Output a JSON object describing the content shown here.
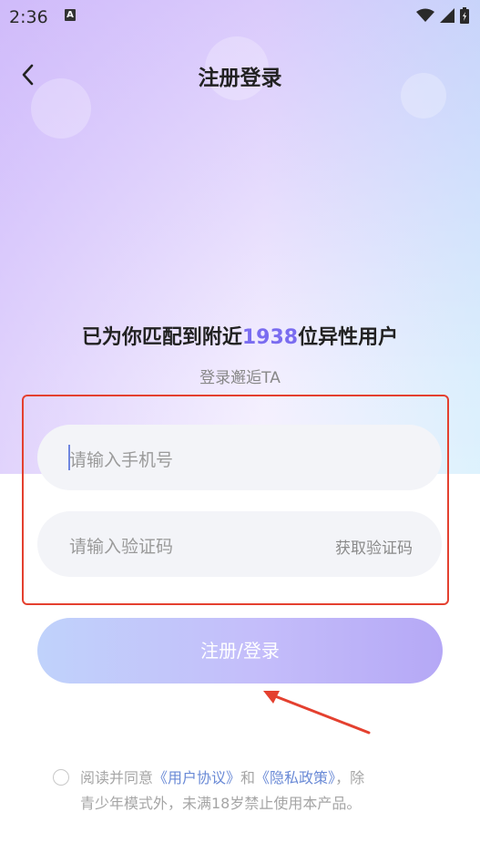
{
  "status_bar": {
    "time": "2:36",
    "notification_glyph": "A"
  },
  "nav": {
    "title": "注册登录"
  },
  "headline": {
    "prefix": "已为你匹配到附近",
    "count": "1938",
    "suffix": "位异性用户"
  },
  "subline": "登录邂逅TA",
  "form": {
    "phone_placeholder": "请输入手机号",
    "code_placeholder": "请输入验证码",
    "get_code_label": "获取验证码",
    "submit_label": "注册/登录"
  },
  "agreement": {
    "lead": "阅读并同意",
    "user_agreement": "《用户协议》",
    "and": "和",
    "privacy_policy": "《隐私政策》",
    "tail1": "，除",
    "line2": "青少年模式外，未满18岁禁止使用本产品。"
  },
  "colors": {
    "highlight": "#7a6cf0",
    "link": "#6a8ad6",
    "annotation": "#e4402f"
  },
  "icons": {
    "back": "chevron-left-icon",
    "wifi": "wifi-icon",
    "signal": "signal-icon",
    "battery": "battery-icon"
  }
}
